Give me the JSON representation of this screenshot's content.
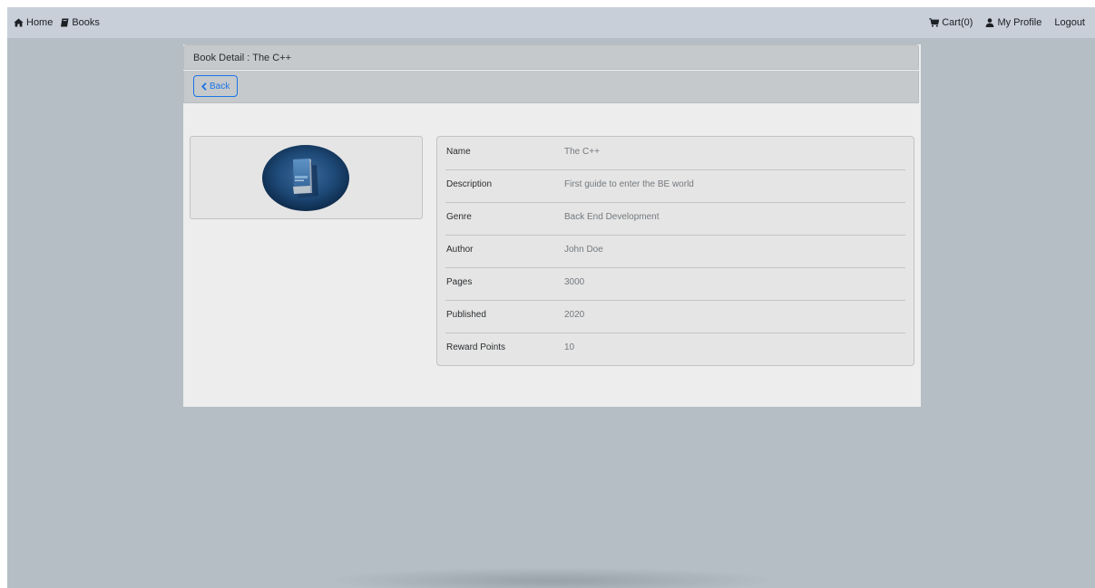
{
  "navbar": {
    "home_label": "Home",
    "books_label": "Books",
    "cart_label": "Cart(0)",
    "profile_label": "My Profile",
    "logout_label": "Logout"
  },
  "panel": {
    "title": "Book Detail : The C++",
    "back_label": "Back"
  },
  "book": {
    "cover_icon": "book-cover-image",
    "details": [
      {
        "label": "Name",
        "value": "The C++"
      },
      {
        "label": "Description",
        "value": "First guide to enter the BE world"
      },
      {
        "label": "Genre",
        "value": "Back End Development"
      },
      {
        "label": "Author",
        "value": "John Doe"
      },
      {
        "label": "Pages",
        "value": "3000"
      },
      {
        "label": "Published",
        "value": "2020"
      },
      {
        "label": "Reward Points",
        "value": "10"
      }
    ]
  },
  "colors": {
    "background": "#b4bec4",
    "navbar": "#c8cfd9",
    "panel_header": "#c5c9cc",
    "accent": "#1a73e8"
  }
}
